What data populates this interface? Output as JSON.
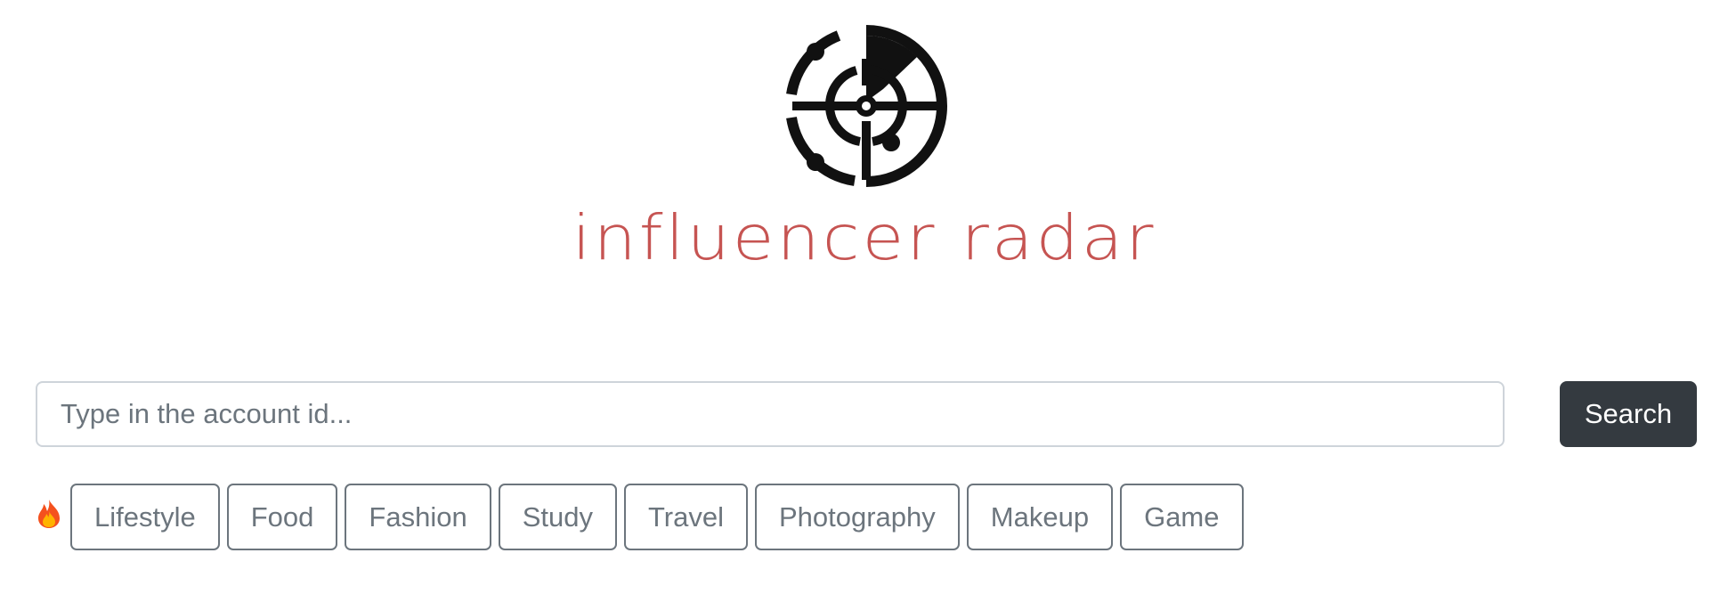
{
  "brand": {
    "name": "influencer radar",
    "logo_icon": "radar-target-icon",
    "color": "#c65452"
  },
  "search": {
    "placeholder": "Type in the account id...",
    "value": "",
    "button_label": "Search",
    "button_color": "#343a40"
  },
  "trending": {
    "icon": "fire-icon",
    "tags": [
      {
        "label": "Lifestyle"
      },
      {
        "label": "Food"
      },
      {
        "label": "Fashion"
      },
      {
        "label": "Study"
      },
      {
        "label": "Travel"
      },
      {
        "label": "Photography"
      },
      {
        "label": "Makeup"
      },
      {
        "label": "Game"
      }
    ]
  }
}
